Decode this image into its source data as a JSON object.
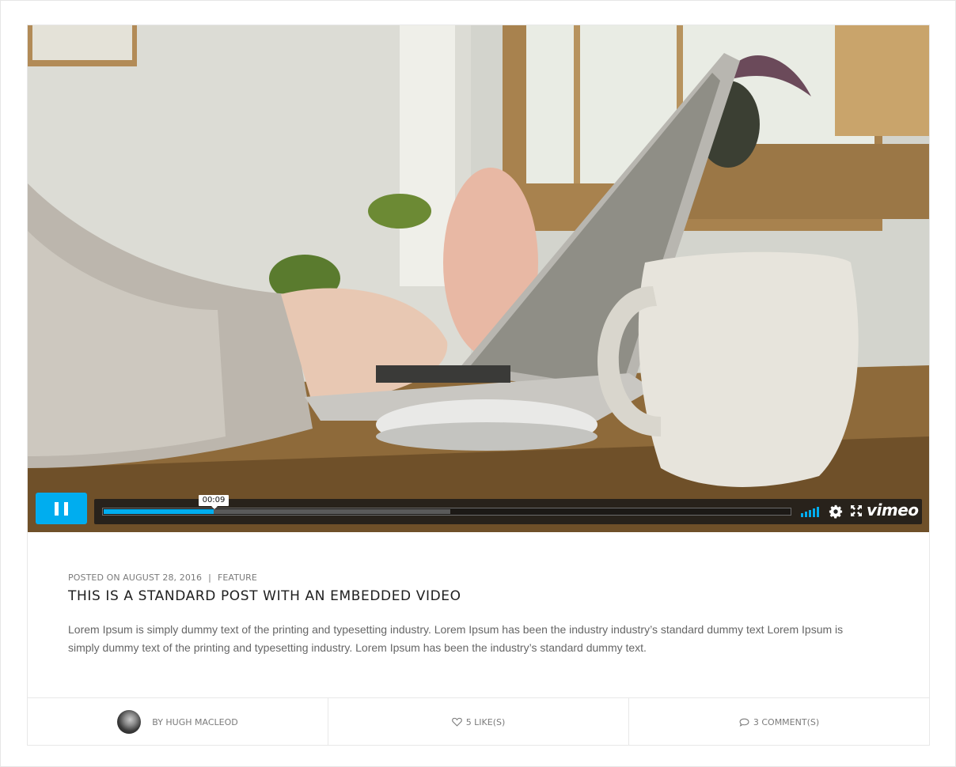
{
  "video": {
    "current_time": "00:09",
    "played_fraction": 0.16,
    "loaded_fraction": 0.505,
    "brand": "vimeo",
    "accent_color": "#00adef",
    "icons": [
      "pause-icon",
      "volume-icon",
      "settings-gear-icon",
      "fullscreen-icon"
    ]
  },
  "post": {
    "posted_on": "POSTED ON AUGUST 28, 2016",
    "category": "FEATURE",
    "title": "THIS IS A STANDARD POST WITH AN EMBEDDED VIDEO",
    "excerpt": "Lorem Ipsum is simply dummy text of the printing and typesetting industry. Lorem Ipsum has been the industry industry’s standard dummy text Lorem Ipsum is simply dummy text of the printing and typesetting industry. Lorem Ipsum has been the industry’s standard dummy text."
  },
  "footer": {
    "author": "BY HUGH MACLEOD",
    "likes": "5 LIKE(S)",
    "comments": "3 COMMENT(S)",
    "icons": [
      "heart-icon",
      "comment-icon"
    ]
  }
}
